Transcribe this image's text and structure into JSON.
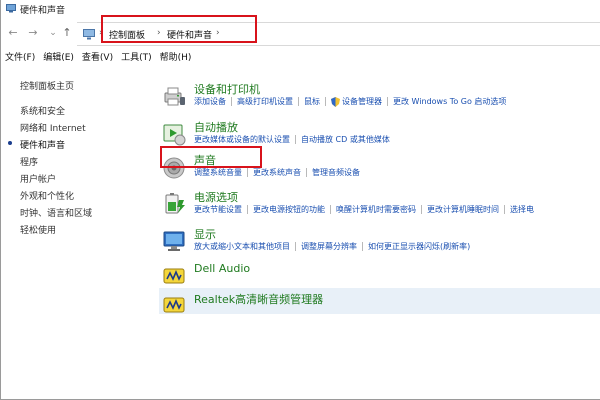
{
  "window": {
    "title": "硬件和声音"
  },
  "nav_buttons": {
    "back": "←",
    "forward": "→",
    "recent": "⌄",
    "up": "↑"
  },
  "address": {
    "sep": "›",
    "crumbs": [
      "控制面板",
      "硬件和声音"
    ]
  },
  "menu": [
    "文件(F)",
    "编辑(E)",
    "查看(V)",
    "工具(T)",
    "帮助(H)"
  ],
  "sidebar": {
    "items": [
      {
        "label": "控制面板主页",
        "active": false
      },
      {
        "label": "系统和安全",
        "active": false
      },
      {
        "label": "网络和 Internet",
        "active": false
      },
      {
        "label": "硬件和声音",
        "active": true
      },
      {
        "label": "程序",
        "active": false
      },
      {
        "label": "用户帐户",
        "active": false
      },
      {
        "label": "外观和个性化",
        "active": false
      },
      {
        "label": "时钟、语言和区域",
        "active": false
      },
      {
        "label": "轻松使用",
        "active": false
      }
    ]
  },
  "categories": [
    {
      "title": "设备和打印机",
      "icon": "printer-icon",
      "links": [
        "添加设备",
        "高级打印机设置",
        "鼠标",
        "设备管理器",
        "更改 Windows To Go 启动选项"
      ]
    },
    {
      "title": "自动播放",
      "icon": "autoplay-icon",
      "links": [
        "更改媒体或设备的默认设置",
        "自动播放 CD 或其他媒体"
      ]
    },
    {
      "title": "声音",
      "icon": "speaker-icon",
      "links": [
        "调整系统音量",
        "更改系统声音",
        "管理音频设备"
      ]
    },
    {
      "title": "电源选项",
      "icon": "power-icon",
      "links": [
        "更改节能设置",
        "更改电源按钮的功能",
        "唤醒计算机时需要密码",
        "更改计算机睡眠时间",
        "选择电"
      ]
    },
    {
      "title": "显示",
      "icon": "display-icon",
      "links": [
        "放大或缩小文本和其他项目",
        "调整屏幕分辨率",
        "如何更正显示器闪烁(刷新率)"
      ]
    },
    {
      "title": "Dell Audio",
      "icon": "audio-icon",
      "links": []
    },
    {
      "title": "Realtek高清晰音频管理器",
      "icon": "audio-icon",
      "links": []
    }
  ],
  "colors": {
    "accent_red": "#d8131b",
    "category_title": "#1f7a1f",
    "link": "#1a4fb0",
    "highlight": "#e8f0f8"
  }
}
